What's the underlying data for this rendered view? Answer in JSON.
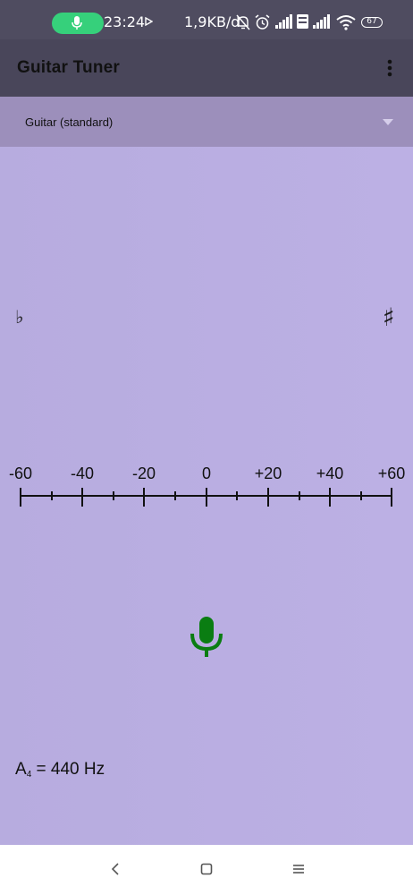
{
  "status_bar": {
    "time": "23:24",
    "network_speed": "1,9KB/d",
    "battery": "67",
    "icons": [
      "mic-icon",
      "play-icon",
      "bell-off-icon",
      "alarm-icon",
      "signal-icon",
      "volte-icon",
      "wifi-icon",
      "battery-icon"
    ]
  },
  "app_bar": {
    "title": "Guitar Tuner",
    "menu_icon": "more-vert-icon"
  },
  "instrument_selector": {
    "selected": "Guitar (standard)"
  },
  "tuner": {
    "flat_symbol": "♭",
    "sharp_symbol": "♯",
    "scale_labels": [
      "-60",
      "-40",
      "-20",
      "0",
      "+20",
      "+40",
      "+60"
    ],
    "mic_color": "#0a7d12",
    "reference": {
      "note": "A",
      "octave": "4",
      "rest": " = 440 Hz"
    }
  },
  "nav_bar": {
    "icons": [
      "back-icon",
      "home-icon",
      "recents-icon"
    ]
  },
  "colors": {
    "status_bar": "#4f4c60",
    "app_bar": "#49465a",
    "dropdown": "#9c8fbb",
    "content": "#b9addf",
    "recording_pill": "#36d07b"
  }
}
